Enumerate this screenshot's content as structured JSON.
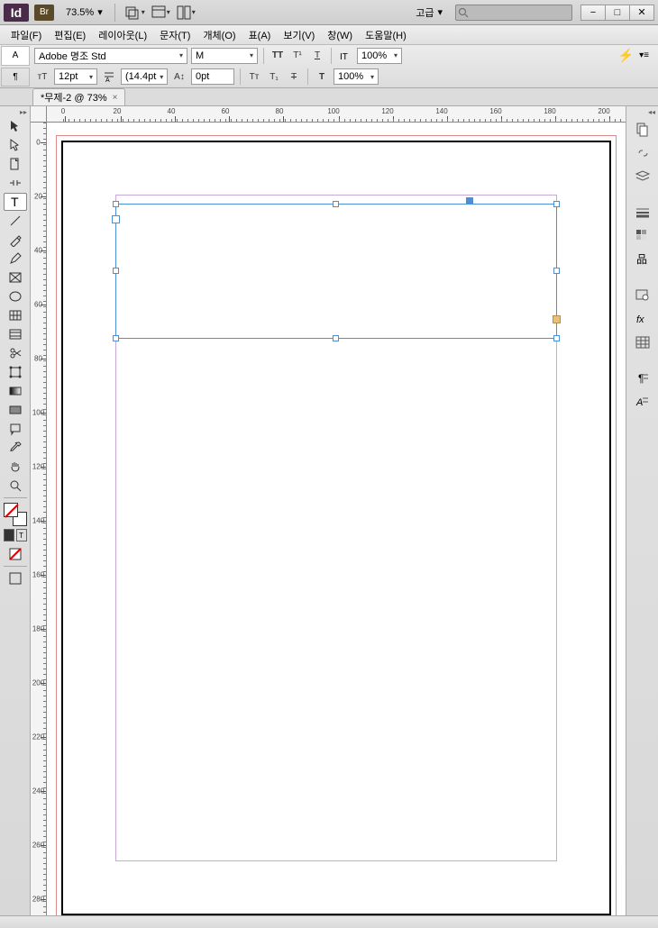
{
  "app": {
    "name": "Id",
    "bridge": "Br"
  },
  "titlebar": {
    "zoom": "73.5%",
    "workspace": "고급"
  },
  "menu": {
    "items": [
      "파일(F)",
      "편집(E)",
      "레이아웃(L)",
      "문자(T)",
      "개체(O)",
      "표(A)",
      "보기(V)",
      "창(W)",
      "도움말(H)"
    ]
  },
  "control": {
    "font_family": "Adobe 명조 Std",
    "font_style": "M",
    "font_size": "12pt",
    "leading": "(14.4pt",
    "baseline_shift": "0pt",
    "horiz_scale": "100%",
    "vert_scale": "100%"
  },
  "doc_tab": {
    "label": "*무제-2 @ 73%"
  },
  "ruler": {
    "h_labels": [
      "0",
      "20",
      "40",
      "60",
      "80",
      "100",
      "120",
      "140",
      "160",
      "180",
      "200"
    ],
    "v_labels": [
      "0",
      "20",
      "40",
      "60",
      "80",
      "100",
      "120",
      "140",
      "160",
      "180",
      "200",
      "220",
      "240",
      "260",
      "280"
    ]
  },
  "icons": {
    "minimize": "−",
    "maximize": "□",
    "close": "✕",
    "dropdown": "▾"
  }
}
